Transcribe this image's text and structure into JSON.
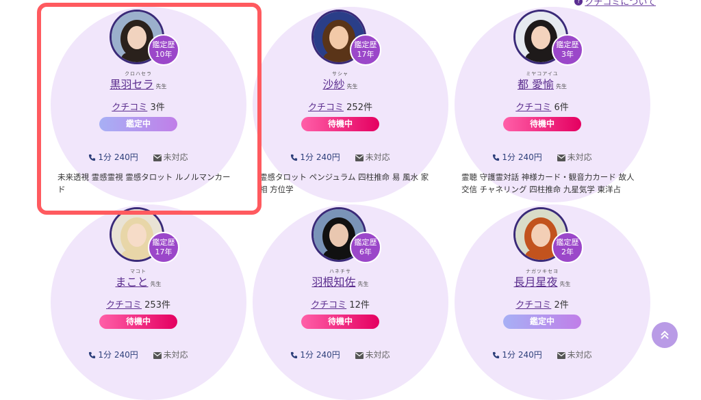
{
  "header": {
    "link_text": "クチコミについて",
    "icon": "question-icon"
  },
  "cards": [
    {
      "kana": "クロハセラ",
      "name": "黒羽セラ",
      "honorific": "先生",
      "badge_label": "鑑定歴",
      "badge_years": "10年",
      "review_label": "クチコミ",
      "review_count": "3件",
      "status": "鑑定中",
      "status_type": "busy",
      "price": "1分 240円",
      "mail": "未対応",
      "desc": "未来透視 霊感霊視 霊感タロット ルノルマンカード",
      "hair": "#2a211c",
      "skin": "#f1d3bf",
      "bg": "#9bb0cc"
    },
    {
      "kana": "サシャ",
      "name": "沙紗",
      "honorific": "先生",
      "badge_label": "鑑定歴",
      "badge_years": "17年",
      "review_label": "クチコミ",
      "review_count": "252件",
      "status": "待機中",
      "status_type": "wait",
      "price": "1分 240円",
      "mail": "未対応",
      "desc": "霊感タロット ペンジュラム 四柱推命 易 風水 家相 方位学",
      "hair": "#5a3418",
      "skin": "#f2c9a8",
      "bg": "#2a3e88"
    },
    {
      "kana": "ミヤコアイユ",
      "name": "都 愛愉",
      "honorific": "先生",
      "badge_label": "鑑定歴",
      "badge_years": "3年",
      "review_label": "クチコミ",
      "review_count": "6件",
      "status": "待機中",
      "status_type": "wait",
      "price": "1分 240円",
      "mail": "未対応",
      "desc": "霊聴 守護霊対話 神様カード・観音力カード 故人交信 チャネリング 四柱推命 九星気学 東洋占",
      "hair": "#1e1a1a",
      "skin": "#f4d3bd",
      "bg": "#e6eaf0"
    },
    {
      "kana": "マコト",
      "name": "まこと",
      "honorific": "先生",
      "badge_label": "鑑定歴",
      "badge_years": "17年",
      "review_label": "クチコミ",
      "review_count": "253件",
      "status": "待機中",
      "status_type": "wait",
      "price": "1分 240円",
      "mail": "未対応",
      "desc": "",
      "hair": "#e8d6a8",
      "skin": "#f6dcc8",
      "bg": "#e9e3d5"
    },
    {
      "kana": "ハネチサ",
      "name": "羽根知佐",
      "honorific": "先生",
      "badge_label": "鑑定歴",
      "badge_years": "6年",
      "review_label": "クチコミ",
      "review_count": "12件",
      "status": "待機中",
      "status_type": "wait",
      "price": "1分 240円",
      "mail": "未対応",
      "desc": "",
      "hair": "#111111",
      "skin": "#e9c7b0",
      "bg": "#7a94b8"
    },
    {
      "kana": "ナガツキセヨ",
      "name": "長月星夜",
      "honorific": "先生",
      "badge_label": "鑑定歴",
      "badge_years": "2年",
      "review_label": "クチコミ",
      "review_count": "2件",
      "status": "鑑定中",
      "status_type": "busy",
      "price": "1分 240円",
      "mail": "未対応",
      "desc": "",
      "hair": "#c2531e",
      "skin": "#f3cfb6",
      "bg": "#d9dcc9"
    }
  ]
}
